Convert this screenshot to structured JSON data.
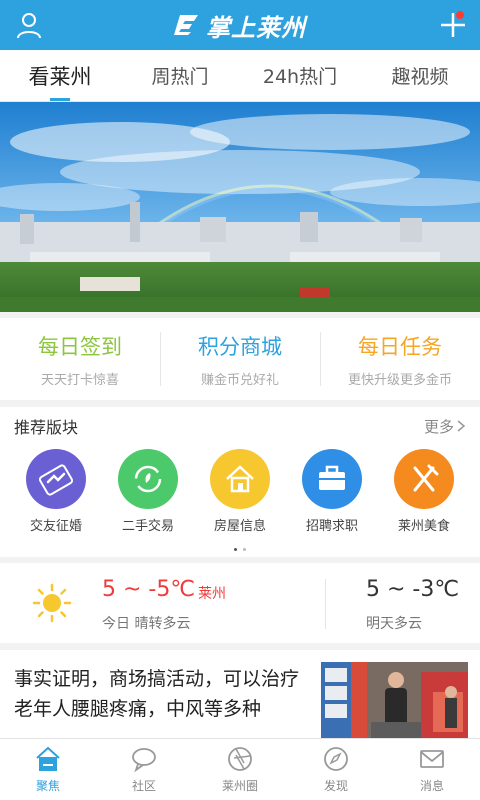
{
  "header": {
    "app_name": "掌上莱州",
    "user_icon": "user-icon",
    "add_icon": "plus-icon"
  },
  "tabs": [
    {
      "label": "看莱州",
      "active": true
    },
    {
      "label": "周热门",
      "active": false
    },
    {
      "label": "24h热门",
      "active": false
    },
    {
      "label": "趣视频",
      "active": false
    }
  ],
  "quick_actions": [
    {
      "title": "每日签到",
      "subtitle": "天天打卡惊喜",
      "color": "#8cc63f"
    },
    {
      "title": "积分商城",
      "subtitle": "赚金币兑好礼",
      "color": "#2ea1df"
    },
    {
      "title": "每日任务",
      "subtitle": "更快升级更多金币",
      "color": "#f5a623"
    }
  ],
  "recommended": {
    "title": "推荐版块",
    "more": "更多",
    "items": [
      {
        "label": "交友征婚",
        "icon": "handshake-icon",
        "color": "#6b5fd4"
      },
      {
        "label": "二手交易",
        "icon": "recycle-icon",
        "color": "#4cc96a"
      },
      {
        "label": "房屋信息",
        "icon": "house-icon",
        "color": "#f7c72f"
      },
      {
        "label": "招聘求职",
        "icon": "briefcase-icon",
        "color": "#2f8fe6"
      },
      {
        "label": "莱州美食",
        "icon": "fork-knife-icon",
        "color": "#f58a1f"
      }
    ]
  },
  "weather": {
    "today_temp": "5 ~ -5℃",
    "city": "莱州",
    "today_desc": "今日 晴转多云",
    "tomorrow_temp": "5 ~ -3℃",
    "tomorrow_desc": "明天多云",
    "icon": "sun-icon"
  },
  "news": {
    "title": "事实证明，商场搞活动，可以治疗老年人腰腿疼痛，中风等多种"
  },
  "bottom_nav": [
    {
      "label": "聚焦",
      "icon": "home-icon",
      "active": true
    },
    {
      "label": "社区",
      "icon": "chat-bubble-icon",
      "active": false
    },
    {
      "label": "莱州圈",
      "icon": "aperture-icon",
      "active": false
    },
    {
      "label": "发现",
      "icon": "compass-icon",
      "active": false
    },
    {
      "label": "消息",
      "icon": "mail-icon",
      "active": false
    }
  ],
  "colors": {
    "brand": "#2ea1df",
    "temp_red": "#ef3b3b"
  }
}
